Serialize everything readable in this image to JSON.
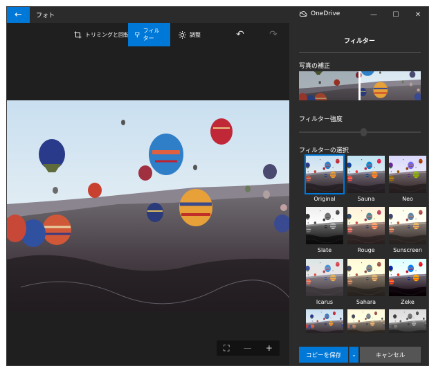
{
  "window": {
    "app_title": "フォト",
    "back_icon": "←",
    "onedrive_label": "OneDrive",
    "minimize_icon": "—",
    "maximize_icon": "☐",
    "close_icon": "✕"
  },
  "toolbar": {
    "crop_label": "トリミングと回転",
    "filter_label": "フィルター",
    "adjust_label": "調整",
    "undo_icon": "↶",
    "redo_icon": "↷"
  },
  "zoom": {
    "fit_icon": "⛶",
    "zoom_out_icon": "—",
    "zoom_in_icon": "+"
  },
  "panel": {
    "title": "フィルター",
    "enhance_label": "写真の補正",
    "intensity_label": "フィルター強度",
    "choose_label": "フィルターの選択",
    "filters": [
      {
        "label": "Original"
      },
      {
        "label": "Sauna"
      },
      {
        "label": "Neo"
      },
      {
        "label": "Slate"
      },
      {
        "label": "Rouge"
      },
      {
        "label": "Sunscreen"
      },
      {
        "label": "Icarus"
      },
      {
        "label": "Sahara"
      },
      {
        "label": "Zeke"
      }
    ],
    "save_copy_label": "コピーを保存",
    "save_split_icon": "⌄",
    "cancel_label": "キャンセル"
  },
  "colors": {
    "accent": "#0078d7",
    "panel_bg": "#2b2b2b",
    "canvas_bg": "#1f1f1f"
  }
}
